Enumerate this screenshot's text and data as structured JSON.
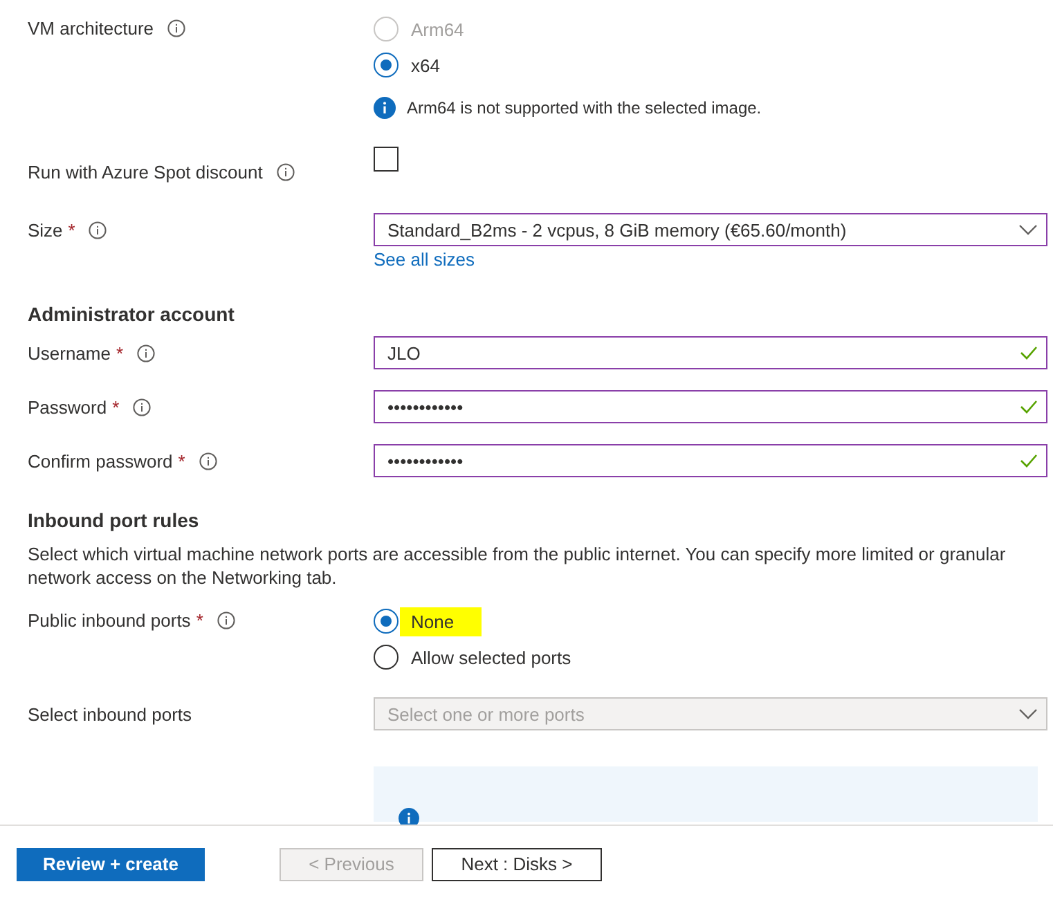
{
  "rows": [
    {
      "kind": "radio",
      "label": "VM architecture",
      "info": true,
      "options": [
        {
          "label": "Arm64",
          "selected": false,
          "disabled": true,
          "highlighted": false
        },
        {
          "label": "x64",
          "selected": true,
          "disabled": false,
          "highlighted": false
        }
      ],
      "note": "Arm64 is not supported with the selected image."
    },
    {
      "kind": "checkbox",
      "label": "Run with Azure Spot discount",
      "info": true,
      "checked": false
    },
    {
      "kind": "dropdown",
      "label": "Size",
      "required_mark": "*",
      "info": true,
      "value": "Standard_B2ms - 2 vcpus, 8 GiB memory (€65.60/month)",
      "disabled": false,
      "link": "See all sizes"
    },
    {
      "kind": "heading",
      "label": "Administrator account"
    },
    {
      "kind": "text",
      "label": "Username",
      "required_mark": "*",
      "info": true,
      "value": "JLO",
      "valid": true
    },
    {
      "kind": "text",
      "label": "Password",
      "required_mark": "*",
      "info": true,
      "value": "••••••••••••",
      "valid": true
    },
    {
      "kind": "text",
      "label": "Confirm password",
      "required_mark": "*",
      "info": true,
      "value": "••••••••••••",
      "valid": true
    },
    {
      "kind": "heading",
      "label": "Inbound port rules"
    },
    {
      "kind": "paragraph",
      "label": "Select which virtual machine network ports are accessible from the public internet. You can specify more limited or granular network access on the Networking tab."
    },
    {
      "kind": "radio",
      "label": "Public inbound ports",
      "required_mark": "*",
      "info": true,
      "options": [
        {
          "label": "None",
          "selected": true,
          "disabled": false,
          "highlighted": true
        },
        {
          "label": "Allow selected ports",
          "selected": false,
          "disabled": false,
          "highlighted": false
        }
      ]
    },
    {
      "kind": "dropdown",
      "label": "Select inbound ports",
      "info": false,
      "placeholder": "Select one or more ports",
      "disabled": true
    },
    {
      "kind": "infobox"
    }
  ],
  "footer": [
    {
      "label": "Review + create",
      "kind": "primary",
      "disabled": false
    },
    {
      "label": "< Previous",
      "kind": "secondary",
      "disabled": true
    },
    {
      "label": "Next : Disks >",
      "kind": "secondary",
      "disabled": false
    }
  ]
}
